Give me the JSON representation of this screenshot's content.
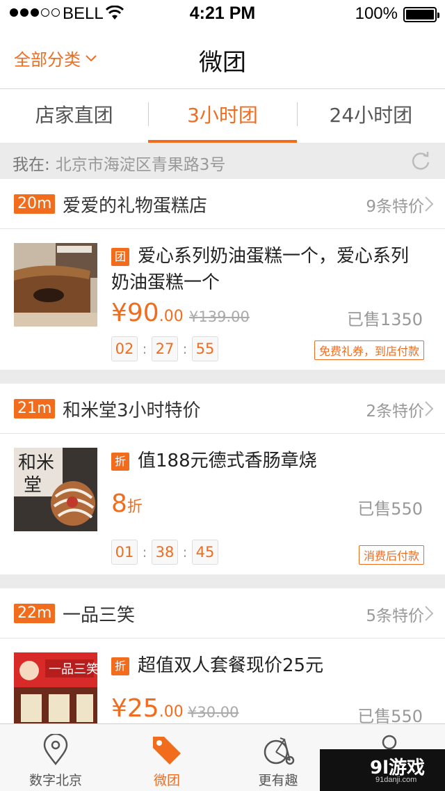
{
  "status_bar": {
    "carrier": "BELL",
    "time": "4:21 PM",
    "battery": "100%"
  },
  "nav": {
    "category_label": "全部分类",
    "title": "微团"
  },
  "tabs": [
    {
      "label": "店家直团"
    },
    {
      "label": "3小时团"
    },
    {
      "label": "24小时团"
    }
  ],
  "location": {
    "prefix": "我在:",
    "address": "北京市海淀区青果路3号"
  },
  "shops": [
    {
      "distance": "20m",
      "name": "爱爱的礼物蛋糕店",
      "more": "9条特价",
      "deal": {
        "badge": "团",
        "title": "爱心系列奶油蛋糕一个，爱心系列奶油蛋糕一个",
        "price_int": "¥90",
        "price_dec": ".00",
        "old_price": "¥139.00",
        "sold": "已售1350",
        "timer": [
          "02",
          "27",
          "55"
        ],
        "tag": "免费礼券，到店付款"
      }
    },
    {
      "distance": "21m",
      "name": "和米堂3小时特价",
      "more": "2条特价",
      "deal": {
        "badge": "折",
        "title": "值188元德式香肠章烧",
        "price_int": "8",
        "price_dec": "折",
        "old_price": "",
        "sold": "已售550",
        "timer": [
          "01",
          "38",
          "45"
        ],
        "tag": "消费后付款"
      }
    },
    {
      "distance": "22m",
      "name": "一品三笑",
      "more": "5条特价",
      "deal": {
        "badge": "折",
        "title": "超值双人套餐现价25元",
        "price_int": "¥25",
        "price_dec": ".00",
        "old_price": "¥30.00",
        "sold": "已售550"
      }
    }
  ],
  "tabbar": [
    {
      "label": "数字北京",
      "icon": "location-pin-icon"
    },
    {
      "label": "微团",
      "icon": "tag-icon"
    },
    {
      "label": "更有趣",
      "icon": "bicycle-icon"
    },
    {
      "label": "",
      "icon": "person-icon"
    }
  ],
  "watermark": {
    "logo": "9l游戏",
    "url": "91danji.com"
  },
  "colors": {
    "accent": "#f26c1e",
    "background": "#ebebeb"
  }
}
